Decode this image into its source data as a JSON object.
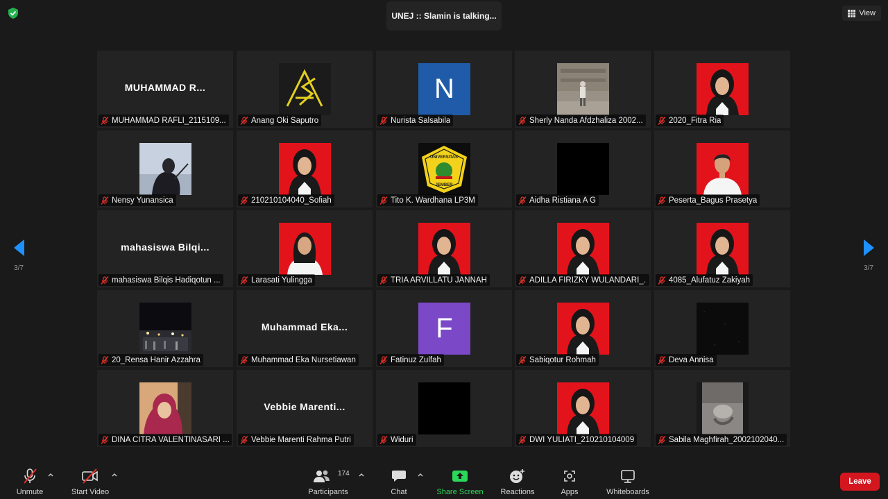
{
  "header": {
    "talking": "UNEJ :: Slamin is talking...",
    "view_label": "View"
  },
  "pagination": {
    "left": "3/7",
    "right": "3/7"
  },
  "tiles": [
    {
      "label": "MUHAMMAD RAFLI_2115109...",
      "type": "name",
      "display": "MUHAMMAD  R..."
    },
    {
      "label": "Anang Oki Saputro",
      "type": "photo",
      "pic": "logo-as"
    },
    {
      "label": "Nurista Salsabila",
      "type": "letter",
      "display": "N",
      "color": "#1f5ba8"
    },
    {
      "label": "Sherly Nanda Afdzhaliza 2002...",
      "type": "photo",
      "pic": "temple"
    },
    {
      "label": "2020_Fitra Ria",
      "type": "photo",
      "pic": "person-hijab-black-red"
    },
    {
      "label": "Nensy Yunansica",
      "type": "photo",
      "pic": "person-sky"
    },
    {
      "label": "210210104040_Sofiah",
      "type": "photo",
      "pic": "person-hijab-black-red"
    },
    {
      "label": "Tito K. Wardhana LP3M",
      "type": "photo",
      "pic": "logo-unej"
    },
    {
      "label": "Aidha Ristiana A G",
      "type": "photo",
      "pic": "black"
    },
    {
      "label": "Peserta_Bagus Prasetya",
      "type": "photo",
      "pic": "person-man-red"
    },
    {
      "label": "mahasiswa Bilqis Hadiqotun ...",
      "type": "name",
      "display": "mahasiswa  Bilqi..."
    },
    {
      "label": "Larasati Yulingga",
      "type": "photo",
      "pic": "person-hair-red"
    },
    {
      "label": "TRIA ARVILLATU JANNAH",
      "type": "photo",
      "pic": "person-hijab-black-red"
    },
    {
      "label": "ADILLA FIRIZKY WULANDARI_...",
      "type": "photo",
      "pic": "person-hijab-black-red"
    },
    {
      "label": "4085_Alufatuz Zakiyah",
      "type": "photo",
      "pic": "person-hijab-black-red"
    },
    {
      "label": "20_Rensa Hanir Azzahra",
      "type": "photo",
      "pic": "night-street"
    },
    {
      "label": "Muhammad Eka Nursetiawan",
      "type": "name",
      "display": "Muhammad  Eka..."
    },
    {
      "label": "Fatinuz Zulfah",
      "type": "letter",
      "display": "F",
      "color": "#7b48c8"
    },
    {
      "label": "Sabiqotur Rohmah",
      "type": "photo",
      "pic": "person-hijab-black-red"
    },
    {
      "label": "Deva Annisa",
      "type": "photo",
      "pic": "dark-noise"
    },
    {
      "label": "DINA CITRA VALENTINASARI ...",
      "type": "photo",
      "pic": "person-hijab-pink"
    },
    {
      "label": "Vebbie Marenti Rahma Putri",
      "type": "name",
      "display": "Vebbie  Marenti..."
    },
    {
      "label": "Widuri",
      "type": "photo",
      "pic": "black"
    },
    {
      "label": "DWI YULIATI_210210104009",
      "type": "photo",
      "pic": "person-hijab-black-red"
    },
    {
      "label": "Sabila Maghfirah_2002102040...",
      "type": "photo",
      "pic": "bw-photo"
    }
  ],
  "toolbar": {
    "unmute": "Unmute",
    "start_video": "Start Video",
    "participants": "Participants",
    "participants_count": "174",
    "chat": "Chat",
    "share_screen": "Share Screen",
    "reactions": "Reactions",
    "apps": "Apps",
    "whiteboards": "Whiteboards",
    "leave": "Leave"
  },
  "colors": {
    "accent_green": "#2bd95a",
    "leave_red": "#d4161f",
    "nav_blue": "#1e90ff",
    "muted_red": "#e0302a"
  }
}
